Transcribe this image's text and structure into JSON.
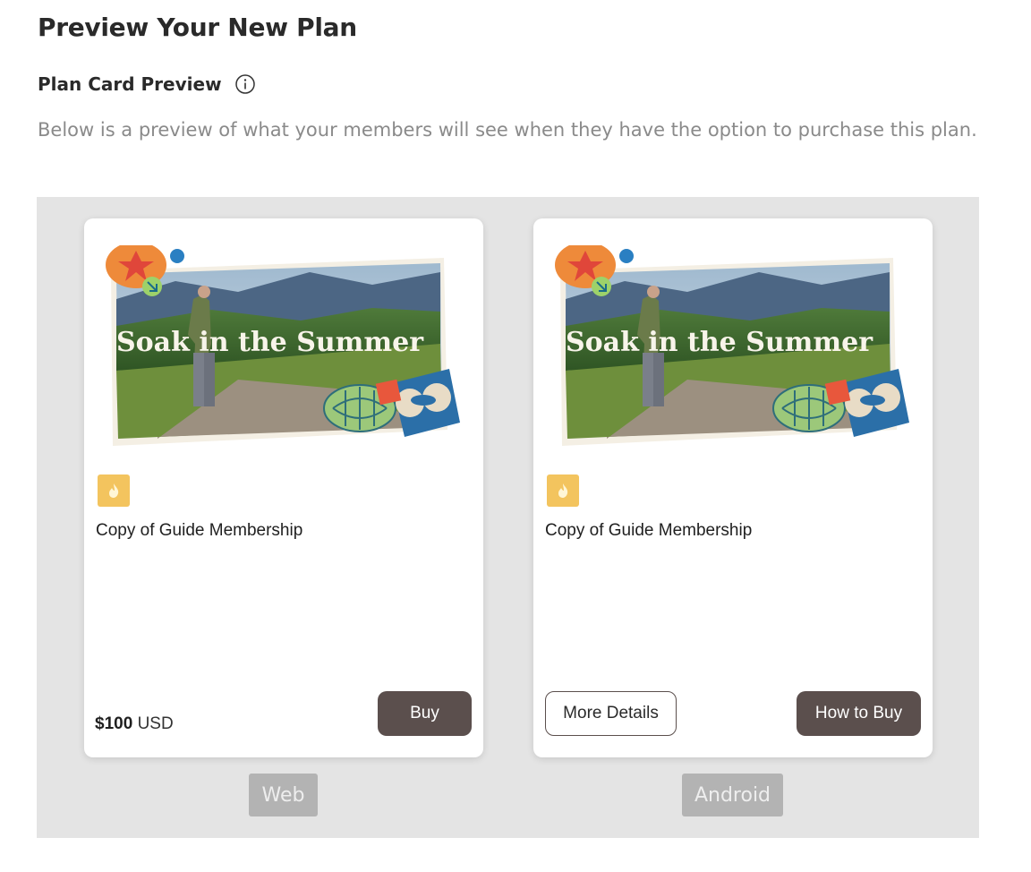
{
  "header": {
    "title": "Preview Your New Plan"
  },
  "section": {
    "title": "Plan Card Preview",
    "description": "Below is a preview of what your members will see when they have the option to purchase this plan."
  },
  "cards": {
    "web": {
      "image_text": "Soak in the Summer",
      "plan_name": "Copy of Guide Membership",
      "price_amount": "$100",
      "price_currency": "USD",
      "buy_label": "Buy"
    },
    "android": {
      "image_text": "Soak in the Summer",
      "plan_name": "Copy of Guide Membership",
      "details_label": "More Details",
      "how_to_buy_label": "How to Buy"
    }
  },
  "platforms": {
    "web": "Web",
    "android": "Android"
  },
  "colors": {
    "button_dark": "#5b4f4d",
    "badge": "#f3c45e",
    "preview_bg": "#e4e4e4",
    "tab_bg": "#b3b3b3"
  },
  "icons": {
    "info": "info-icon",
    "badge": "flame-icon"
  }
}
